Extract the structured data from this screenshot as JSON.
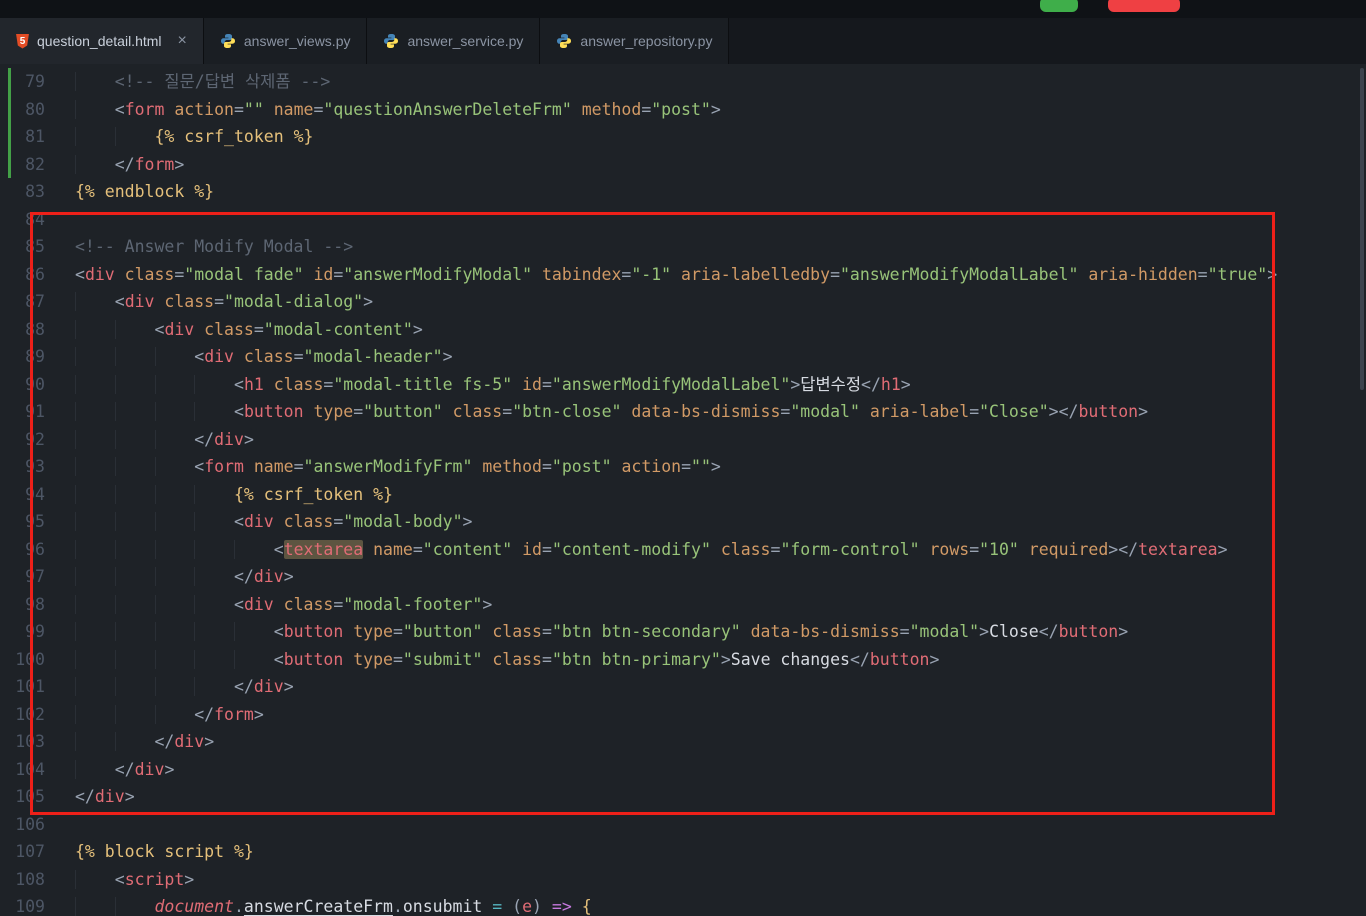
{
  "colors": {
    "editor_bg": "#1e2227",
    "tabbar_bg": "#15181d",
    "tab_active_bg": "#22262c",
    "annotation_red": "#ee2019",
    "chg_green": "#43a047",
    "accent_green": "#3fae4a",
    "accent_red": "#ef4043"
  },
  "tabs": [
    {
      "label": "question_detail.html",
      "icon": "html",
      "active": true,
      "close_glyph": "×"
    },
    {
      "label": "answer_views.py",
      "icon": "python",
      "active": false
    },
    {
      "label": "answer_service.py",
      "icon": "python",
      "active": false
    },
    {
      "label": "answer_repository.py",
      "icon": "python",
      "active": false
    }
  ],
  "editor": {
    "lines": [
      {
        "n": 79,
        "ind": 4,
        "chg": true,
        "tok": [
          [
            "com",
            "<!-- 질문/답변 삭제폼 -->"
          ]
        ]
      },
      {
        "n": 80,
        "ind": 4,
        "chg": true,
        "tok": [
          [
            "brk",
            "<"
          ],
          [
            "tag",
            "form"
          ],
          [
            "attr",
            " action"
          ],
          [
            "brk",
            "="
          ],
          [
            "str",
            "\"\""
          ],
          [
            "attr",
            " name"
          ],
          [
            "brk",
            "="
          ],
          [
            "str",
            "\"questionAnswerDeleteFrm\""
          ],
          [
            "attr",
            " method"
          ],
          [
            "brk",
            "="
          ],
          [
            "str",
            "\"post\""
          ],
          [
            "brk",
            ">"
          ]
        ]
      },
      {
        "n": 81,
        "ind": 8,
        "chg": true,
        "tok": [
          [
            "tpl",
            "{% csrf_token %}"
          ]
        ]
      },
      {
        "n": 82,
        "ind": 4,
        "chg": true,
        "tok": [
          [
            "brk",
            "</"
          ],
          [
            "tag",
            "form"
          ],
          [
            "brk",
            ">"
          ]
        ]
      },
      {
        "n": 83,
        "ind": 0,
        "tok": [
          [
            "tpl",
            "{% endblock %}"
          ]
        ]
      },
      {
        "n": 84,
        "ind": 0,
        "tok": []
      },
      {
        "n": 85,
        "ind": 0,
        "tok": [
          [
            "com",
            "<!-- Answer Modify Modal -->"
          ]
        ]
      },
      {
        "n": 86,
        "ind": 0,
        "tok": [
          [
            "brk",
            "<"
          ],
          [
            "tag",
            "div"
          ],
          [
            "attr",
            " class"
          ],
          [
            "brk",
            "="
          ],
          [
            "str",
            "\"modal fade\""
          ],
          [
            "attr",
            " id"
          ],
          [
            "brk",
            "="
          ],
          [
            "str",
            "\"answerModifyModal\""
          ],
          [
            "attr",
            " tabindex"
          ],
          [
            "brk",
            "="
          ],
          [
            "str",
            "\"-1\""
          ],
          [
            "attr",
            " aria-labelledby"
          ],
          [
            "brk",
            "="
          ],
          [
            "str",
            "\"answerModifyModalLabel\""
          ],
          [
            "attr",
            " aria-hidden"
          ],
          [
            "brk",
            "="
          ],
          [
            "str",
            "\"true\""
          ],
          [
            "brk",
            ">"
          ]
        ]
      },
      {
        "n": 87,
        "ind": 4,
        "tok": [
          [
            "brk",
            "<"
          ],
          [
            "tag",
            "div"
          ],
          [
            "attr",
            " class"
          ],
          [
            "brk",
            "="
          ],
          [
            "str",
            "\"modal-dialog\""
          ],
          [
            "brk",
            ">"
          ]
        ]
      },
      {
        "n": 88,
        "ind": 8,
        "tok": [
          [
            "brk",
            "<"
          ],
          [
            "tag",
            "div"
          ],
          [
            "attr",
            " class"
          ],
          [
            "brk",
            "="
          ],
          [
            "str",
            "\"modal-content\""
          ],
          [
            "brk",
            ">"
          ]
        ]
      },
      {
        "n": 89,
        "ind": 12,
        "tok": [
          [
            "brk",
            "<"
          ],
          [
            "tag",
            "div"
          ],
          [
            "attr",
            " class"
          ],
          [
            "brk",
            "="
          ],
          [
            "str",
            "\"modal-header\""
          ],
          [
            "brk",
            ">"
          ]
        ]
      },
      {
        "n": 90,
        "ind": 16,
        "tok": [
          [
            "brk",
            "<"
          ],
          [
            "tag",
            "h1"
          ],
          [
            "attr",
            " class"
          ],
          [
            "brk",
            "="
          ],
          [
            "str",
            "\"modal-title fs-5\""
          ],
          [
            "attr",
            " id"
          ],
          [
            "brk",
            "="
          ],
          [
            "str",
            "\"answerModifyModalLabel\""
          ],
          [
            "brk",
            ">"
          ],
          [
            "txt",
            "답변수정"
          ],
          [
            "brk",
            "</"
          ],
          [
            "tag",
            "h1"
          ],
          [
            "brk",
            ">"
          ]
        ]
      },
      {
        "n": 91,
        "ind": 16,
        "tok": [
          [
            "brk",
            "<"
          ],
          [
            "tag",
            "button"
          ],
          [
            "attr",
            " type"
          ],
          [
            "brk",
            "="
          ],
          [
            "str",
            "\"button\""
          ],
          [
            "attr",
            " class"
          ],
          [
            "brk",
            "="
          ],
          [
            "str",
            "\"btn-close\""
          ],
          [
            "attr",
            " data-bs-dismiss"
          ],
          [
            "brk",
            "="
          ],
          [
            "str",
            "\"modal\""
          ],
          [
            "attr",
            " aria-label"
          ],
          [
            "brk",
            "="
          ],
          [
            "str",
            "\"Close\""
          ],
          [
            "brk",
            "></"
          ],
          [
            "tag",
            "button"
          ],
          [
            "brk",
            ">"
          ]
        ]
      },
      {
        "n": 92,
        "ind": 12,
        "tok": [
          [
            "brk",
            "</"
          ],
          [
            "tag",
            "div"
          ],
          [
            "brk",
            ">"
          ]
        ]
      },
      {
        "n": 93,
        "ind": 12,
        "tok": [
          [
            "brk",
            "<"
          ],
          [
            "tag",
            "form"
          ],
          [
            "attr",
            " name"
          ],
          [
            "brk",
            "="
          ],
          [
            "str",
            "\"answerModifyFrm\""
          ],
          [
            "attr",
            " method"
          ],
          [
            "brk",
            "="
          ],
          [
            "str",
            "\"post\""
          ],
          [
            "attr",
            " action"
          ],
          [
            "brk",
            "="
          ],
          [
            "str",
            "\"\""
          ],
          [
            "brk",
            ">"
          ]
        ]
      },
      {
        "n": 94,
        "ind": 16,
        "tok": [
          [
            "tpl",
            "{% csrf_token %}"
          ]
        ]
      },
      {
        "n": 95,
        "ind": 16,
        "tok": [
          [
            "brk",
            "<"
          ],
          [
            "tag",
            "div"
          ],
          [
            "attr",
            " class"
          ],
          [
            "brk",
            "="
          ],
          [
            "str",
            "\"modal-body\""
          ],
          [
            "brk",
            ">"
          ]
        ]
      },
      {
        "n": 96,
        "ind": 20,
        "tok": [
          [
            "brk",
            "<"
          ],
          [
            "tag hl",
            "textarea"
          ],
          [
            "attr",
            " name"
          ],
          [
            "brk",
            "="
          ],
          [
            "str",
            "\"content\""
          ],
          [
            "attr",
            " id"
          ],
          [
            "brk",
            "="
          ],
          [
            "str",
            "\"content-modify\""
          ],
          [
            "attr",
            " class"
          ],
          [
            "brk",
            "="
          ],
          [
            "str",
            "\"form-control\""
          ],
          [
            "attr",
            " rows"
          ],
          [
            "brk",
            "="
          ],
          [
            "str",
            "\"10\""
          ],
          [
            "attr",
            " required"
          ],
          [
            "brk",
            "></"
          ],
          [
            "tag",
            "textarea"
          ],
          [
            "brk",
            ">"
          ]
        ]
      },
      {
        "n": 97,
        "ind": 16,
        "tok": [
          [
            "brk",
            "</"
          ],
          [
            "tag",
            "div"
          ],
          [
            "brk",
            ">"
          ]
        ]
      },
      {
        "n": 98,
        "ind": 16,
        "tok": [
          [
            "brk",
            "<"
          ],
          [
            "tag",
            "div"
          ],
          [
            "attr",
            " class"
          ],
          [
            "brk",
            "="
          ],
          [
            "str",
            "\"modal-footer\""
          ],
          [
            "brk",
            ">"
          ]
        ]
      },
      {
        "n": 99,
        "ind": 20,
        "tok": [
          [
            "brk",
            "<"
          ],
          [
            "tag",
            "button"
          ],
          [
            "attr",
            " type"
          ],
          [
            "brk",
            "="
          ],
          [
            "str",
            "\"button\""
          ],
          [
            "attr",
            " class"
          ],
          [
            "brk",
            "="
          ],
          [
            "str",
            "\"btn btn-secondary\""
          ],
          [
            "attr",
            " data-bs-dismiss"
          ],
          [
            "brk",
            "="
          ],
          [
            "str",
            "\"modal\""
          ],
          [
            "brk",
            ">"
          ],
          [
            "txt",
            "Close"
          ],
          [
            "brk",
            "</"
          ],
          [
            "tag",
            "button"
          ],
          [
            "brk",
            ">"
          ]
        ]
      },
      {
        "n": 100,
        "ind": 20,
        "tok": [
          [
            "brk",
            "<"
          ],
          [
            "tag",
            "button"
          ],
          [
            "attr",
            " type"
          ],
          [
            "brk",
            "="
          ],
          [
            "str",
            "\"submit\""
          ],
          [
            "attr",
            " class"
          ],
          [
            "brk",
            "="
          ],
          [
            "str",
            "\"btn btn-primary\""
          ],
          [
            "brk",
            ">"
          ],
          [
            "txt",
            "Save changes"
          ],
          [
            "brk",
            "</"
          ],
          [
            "tag",
            "button"
          ],
          [
            "brk",
            ">"
          ]
        ]
      },
      {
        "n": 101,
        "ind": 16,
        "tok": [
          [
            "brk",
            "</"
          ],
          [
            "tag",
            "div"
          ],
          [
            "brk",
            ">"
          ]
        ]
      },
      {
        "n": 102,
        "ind": 12,
        "tok": [
          [
            "brk",
            "</"
          ],
          [
            "tag",
            "form"
          ],
          [
            "brk",
            ">"
          ]
        ]
      },
      {
        "n": 103,
        "ind": 8,
        "tok": [
          [
            "brk",
            "</"
          ],
          [
            "tag",
            "div"
          ],
          [
            "brk",
            ">"
          ]
        ]
      },
      {
        "n": 104,
        "ind": 4,
        "tok": [
          [
            "brk",
            "</"
          ],
          [
            "tag",
            "div"
          ],
          [
            "brk",
            ">"
          ]
        ]
      },
      {
        "n": 105,
        "ind": 0,
        "tok": [
          [
            "brk",
            "</"
          ],
          [
            "tag",
            "div"
          ],
          [
            "brk",
            ">"
          ]
        ]
      },
      {
        "n": 106,
        "ind": 0,
        "tok": []
      },
      {
        "n": 107,
        "ind": 0,
        "tok": [
          [
            "tpl",
            "{% block script %}"
          ]
        ]
      },
      {
        "n": 108,
        "ind": 4,
        "tok": [
          [
            "brk",
            "<"
          ],
          [
            "tag",
            "script"
          ],
          [
            "brk",
            ">"
          ]
        ]
      },
      {
        "n": 109,
        "ind": 8,
        "tok": [
          [
            "doc",
            "document"
          ],
          [
            "brk",
            "."
          ],
          [
            "und",
            "answerCreateFrm"
          ],
          [
            "brk",
            "."
          ],
          [
            "txt",
            "onsubmit"
          ],
          [
            "op",
            " = "
          ],
          [
            "brk",
            "("
          ],
          [
            "param",
            "e"
          ],
          [
            "brk",
            ")"
          ],
          [
            "kw",
            " =>"
          ],
          [
            "tpl",
            " {"
          ]
        ]
      }
    ]
  }
}
